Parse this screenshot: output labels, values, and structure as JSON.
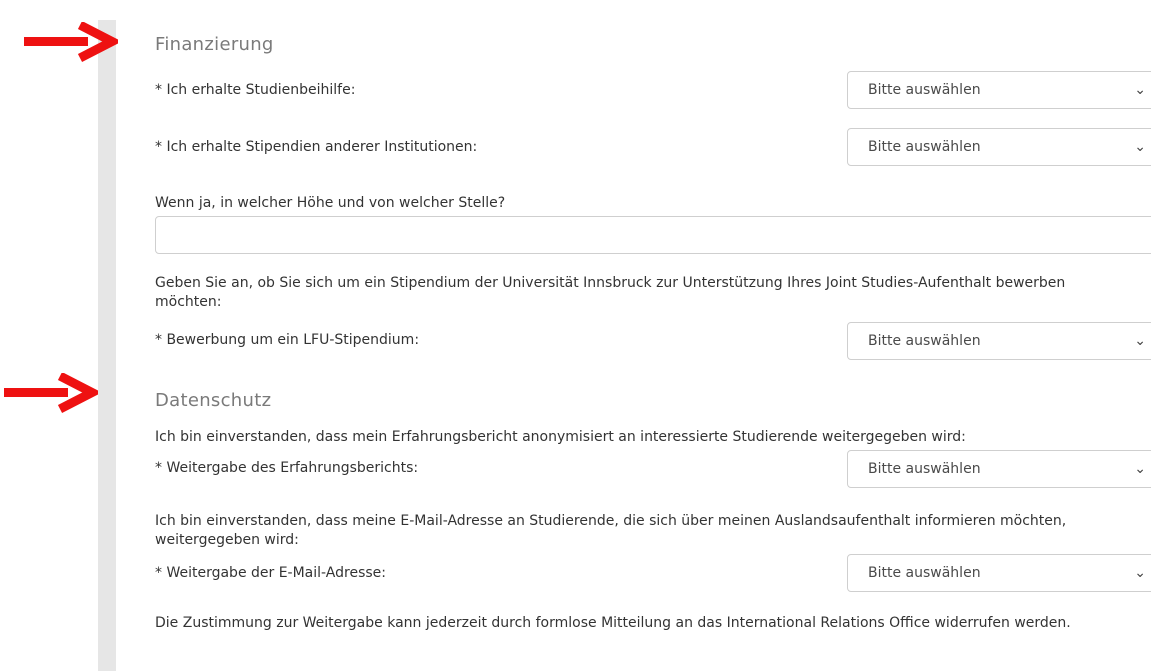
{
  "colors": {
    "arrow": "#ee1111",
    "left_bar": "#e6e6e6",
    "section_title": "#7a7a7a"
  },
  "icons": {
    "arrow": "right-arrow-icon",
    "chevron": "chevron-down-icon"
  },
  "finanzierung": {
    "title": "Finanzierung",
    "studienbeihilfe": {
      "label": "* Ich erhalte Studienbeihilfe:",
      "value": "Bitte auswählen"
    },
    "stipendien": {
      "label": "* Ich erhalte Stipendien anderer Institutionen:",
      "value": "Bitte auswählen"
    },
    "hoehe": {
      "label": "Wenn ja, in welcher Höhe und von welcher Stelle?",
      "value": ""
    },
    "lfu_intro": "Geben Sie an, ob Sie sich um ein Stipendium der Universität Innsbruck zur Unterstützung Ihres Joint Studies-Aufenthalt bewerben möchten:",
    "lfu": {
      "label": "* Bewerbung um ein LFU-Stipendium:",
      "value": "Bitte auswählen"
    }
  },
  "datenschutz": {
    "title": "Datenschutz",
    "bericht_intro": "Ich bin einverstanden, dass mein Erfahrungsbericht anonymisiert an interessierte Studierende weitergegeben wird:",
    "bericht": {
      "label": "* Weitergabe des Erfahrungsberichts:",
      "value": "Bitte auswählen"
    },
    "email_intro": "Ich bin einverstanden, dass meine E-Mail-Adresse an Studierende, die sich über meinen Auslandsaufenthalt informieren möchten, weitergegeben wird:",
    "email": {
      "label": "* Weitergabe der E-Mail-Adresse:",
      "value": "Bitte auswählen"
    },
    "widerruf": "Die Zustimmung zur Weitergabe kann jederzeit durch formlose Mitteilung an das International Relations Office widerrufen werden."
  },
  "chevron_glyph": "⌄"
}
